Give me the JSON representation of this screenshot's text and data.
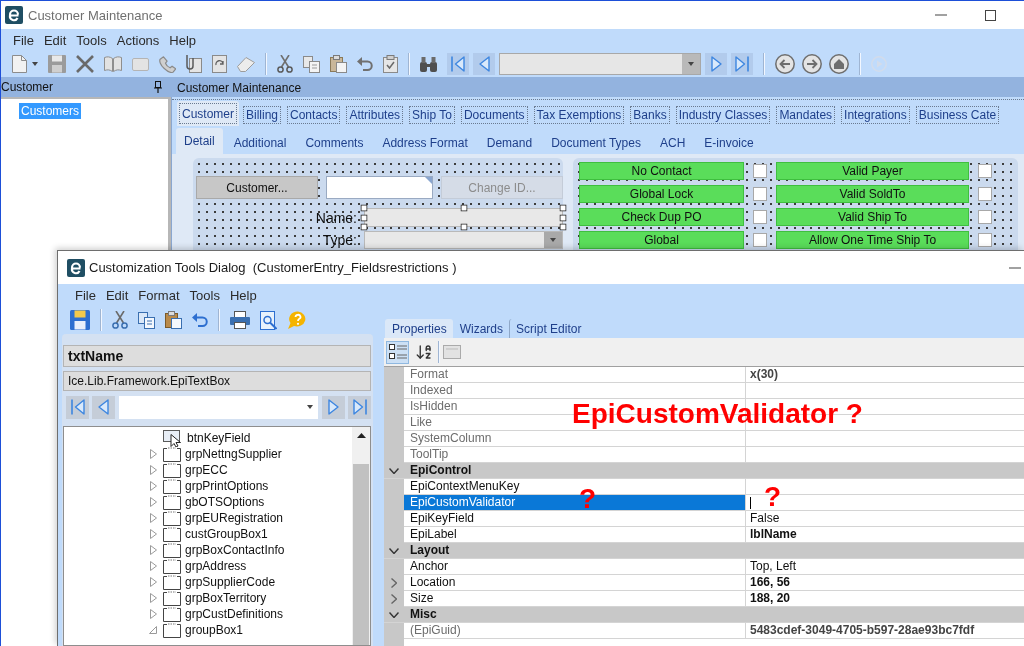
{
  "main_window": {
    "title": "Customer Maintenance",
    "menu": [
      "File",
      "Edit",
      "Tools",
      "Actions",
      "Help"
    ],
    "navigator": {
      "title": "Customer",
      "items": [
        {
          "label": "Customers",
          "selected": true
        }
      ]
    },
    "content_title": "Customer Maintenance",
    "tabs": [
      {
        "label": "Customer",
        "selected": true
      },
      {
        "label": "Billing",
        "selected": false
      },
      {
        "label": "Contacts",
        "selected": false
      },
      {
        "label": "Attributes",
        "selected": false
      },
      {
        "label": "Ship To",
        "selected": false
      },
      {
        "label": "Documents",
        "selected": false
      },
      {
        "label": "Tax Exemptions",
        "selected": false
      },
      {
        "label": "Banks",
        "selected": false
      },
      {
        "label": "Industry Classes",
        "selected": false
      },
      {
        "label": "Mandates",
        "selected": false
      },
      {
        "label": "Integrations",
        "selected": false
      },
      {
        "label": "Business Cate",
        "selected": false
      }
    ],
    "subtabs": [
      {
        "label": "Detail",
        "selected": true
      },
      {
        "label": "Additional",
        "selected": false
      },
      {
        "label": "Comments",
        "selected": false
      },
      {
        "label": "Address Format",
        "selected": false
      },
      {
        "label": "Demand",
        "selected": false
      },
      {
        "label": "Document Types",
        "selected": false
      },
      {
        "label": "ACH",
        "selected": false
      },
      {
        "label": "E-invoice",
        "selected": false
      }
    ],
    "detail": {
      "customer_button": "Customer...",
      "change_id_button": {
        "label": "Change ID...",
        "disabled": true
      },
      "fields": [
        {
          "label": "Name:",
          "kind": "text",
          "selected": true
        },
        {
          "label": "Type:",
          "kind": "combo",
          "selected": false
        }
      ],
      "flags": [
        {
          "label": "No Contact",
          "checked": false
        },
        {
          "label": "Valid Payer",
          "checked": false
        },
        {
          "label": "Global Lock",
          "checked": false
        },
        {
          "label": "Valid SoldTo",
          "checked": false
        },
        {
          "label": "Check Dup PO",
          "checked": false
        },
        {
          "label": "Valid Ship To",
          "checked": false
        },
        {
          "label": "Global",
          "checked": false
        },
        {
          "label": "Allow One Time Ship To",
          "checked": false
        }
      ]
    }
  },
  "dialog": {
    "title": "Customization Tools Dialog  (CustomerEntry_Fieldsrestrictions )",
    "menu": [
      "File",
      "Edit",
      "Format",
      "Tools",
      "Help"
    ],
    "control_name": "txtName",
    "control_type": "Ice.Lib.Framework.EpiTextBox",
    "tree": [
      {
        "label": "btnKeyField",
        "kind": "button"
      },
      {
        "label": "grpNettngSupplier",
        "kind": "group",
        "expanded": false
      },
      {
        "label": "grpECC",
        "kind": "group",
        "expanded": false
      },
      {
        "label": "grpPrintOptions",
        "kind": "group",
        "expanded": false
      },
      {
        "label": "gbOTSOptions",
        "kind": "group",
        "expanded": false
      },
      {
        "label": "grpEURegistration",
        "kind": "group",
        "expanded": false
      },
      {
        "label": "custGroupBox1",
        "kind": "group",
        "expanded": false
      },
      {
        "label": "grpBoxContactInfo",
        "kind": "group",
        "expanded": false
      },
      {
        "label": "grpAddress",
        "kind": "group",
        "expanded": false
      },
      {
        "label": "grpSupplierCode",
        "kind": "group",
        "expanded": false
      },
      {
        "label": "grpBoxTerritory",
        "kind": "group",
        "expanded": false
      },
      {
        "label": "grpCustDefinitions",
        "kind": "group",
        "expanded": false
      },
      {
        "label": "groupBox1",
        "kind": "group",
        "expanded": true
      }
    ],
    "panel_tabs": [
      {
        "label": "Properties",
        "selected": true
      },
      {
        "label": "Wizards",
        "selected": false
      },
      {
        "label": "Script Editor",
        "selected": false
      }
    ],
    "view_buttons": [
      {
        "kind": "categorized",
        "selected": true
      },
      {
        "kind": "alphabetical",
        "selected": false
      }
    ],
    "property_grid": {
      "groups": [
        {
          "rows": [
            {
              "name": "Format",
              "value": "x(30)",
              "modified": true,
              "read_only": true,
              "selected": false,
              "kind": "field"
            },
            {
              "name": "Indexed",
              "read_only": true,
              "selected": false,
              "kind": "field"
            },
            {
              "name": "IsHidden",
              "read_only": true,
              "selected": false,
              "kind": "field"
            },
            {
              "name": "Like",
              "read_only": true,
              "selected": false,
              "kind": "field"
            },
            {
              "name": "SystemColumn",
              "read_only": true,
              "selected": false,
              "kind": "field"
            },
            {
              "name": "ToolTip",
              "read_only": true,
              "selected": false,
              "kind": "field"
            }
          ]
        },
        {
          "name": "EpiControl",
          "expanded": true,
          "rows": [
            {
              "name": "EpiContextMenuKey",
              "read_only": false,
              "selected": false,
              "kind": "field"
            },
            {
              "name": "EpiCustomValidator",
              "read_only": false,
              "selected": true,
              "kind": "field"
            },
            {
              "name": "EpiKeyField",
              "value": "False",
              "modified": false,
              "read_only": false,
              "selected": false,
              "kind": "field"
            },
            {
              "name": "EpiLabel",
              "value": "lblName",
              "modified": true,
              "read_only": false,
              "selected": false,
              "kind": "field"
            }
          ]
        },
        {
          "name": "Layout",
          "expanded": true,
          "rows": [
            {
              "name": "Anchor",
              "value": "Top, Left",
              "modified": false,
              "read_only": false,
              "selected": false,
              "kind": "field"
            },
            {
              "name": "Location",
              "value": "166, 56",
              "modified": true,
              "read_only": false,
              "selected": false,
              "kind": "composite",
              "expanded": false
            },
            {
              "name": "Size",
              "value": "188, 20",
              "modified": true,
              "read_only": false,
              "selected": false,
              "kind": "composite",
              "expanded": false
            }
          ]
        },
        {
          "name": "Misc",
          "expanded": true,
          "rows": [
            {
              "name": "(EpiGuid)",
              "value": "5483cdef-3049-4705-b597-28ae93bc7fdf",
              "modified": true,
              "read_only": true,
              "selected": false,
              "kind": "field"
            }
          ]
        }
      ]
    }
  },
  "annotations": {
    "callout": "EpiCustomValidator ?",
    "marks": [
      "?",
      "?"
    ]
  }
}
